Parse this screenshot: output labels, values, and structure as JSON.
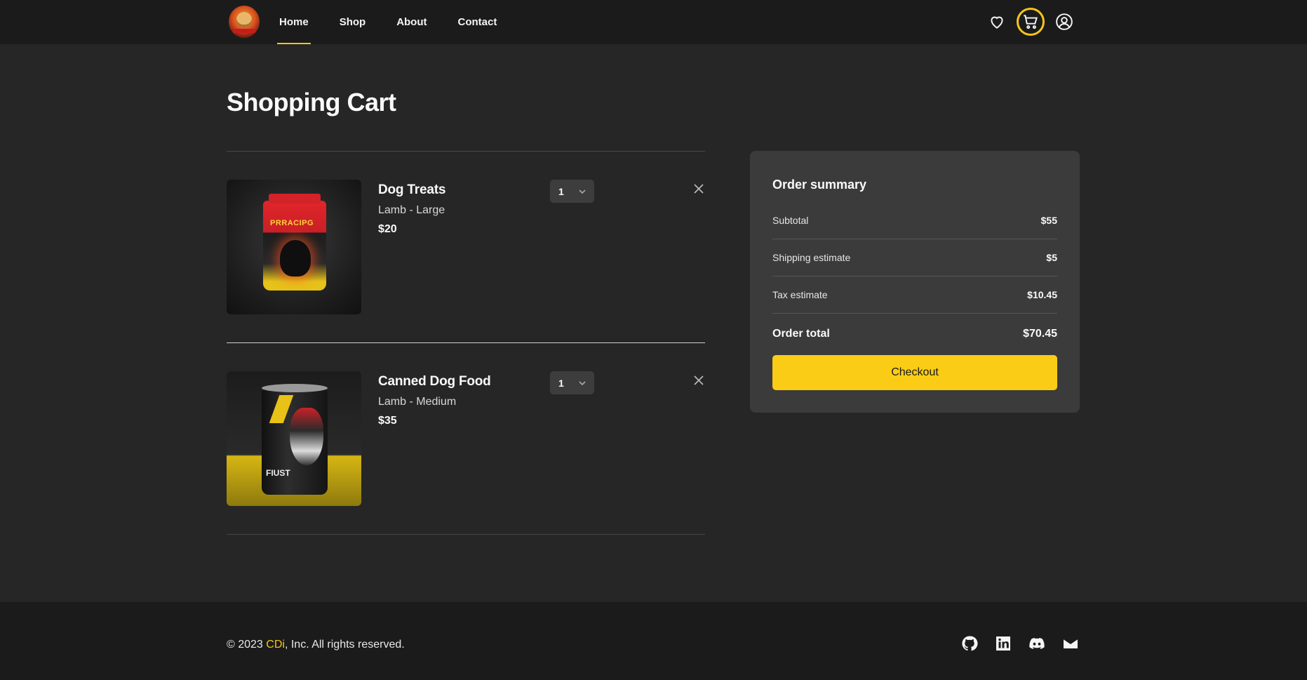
{
  "nav": {
    "links": [
      {
        "label": "Home",
        "active": true
      },
      {
        "label": "Shop"
      },
      {
        "label": "About"
      },
      {
        "label": "Contact"
      }
    ],
    "icons": [
      "heart-icon",
      "cart-icon",
      "user-icon"
    ]
  },
  "page": {
    "title": "Shopping Cart"
  },
  "cart": {
    "items": [
      {
        "name": "Dog Treats",
        "variant": "Lamb - Large",
        "price": "$20",
        "qty": "1",
        "image_label": "PRRACIPG"
      },
      {
        "name": "Canned Dog Food",
        "variant": "Lamb - Medium",
        "price": "$35",
        "qty": "1",
        "image_label": "FIUST"
      }
    ]
  },
  "summary": {
    "title": "Order summary",
    "subtotal_label": "Subtotal",
    "subtotal": "$55",
    "shipping_label": "Shipping estimate",
    "shipping": "$5",
    "tax_label": "Tax estimate",
    "tax": "$10.45",
    "total_label": "Order total",
    "total": "$70.45",
    "checkout_label": "Checkout"
  },
  "footer": {
    "copy_prefix": "© 2023 ",
    "brand": "CDi",
    "copy_suffix": ", Inc. All rights reserved.",
    "social": [
      "github-icon",
      "linkedin-icon",
      "discord-icon",
      "mail-icon"
    ]
  },
  "colors": {
    "accent": "#facc15",
    "background": "#262626",
    "panel": "#3b3b3b",
    "navbar": "#1b1b1b"
  }
}
